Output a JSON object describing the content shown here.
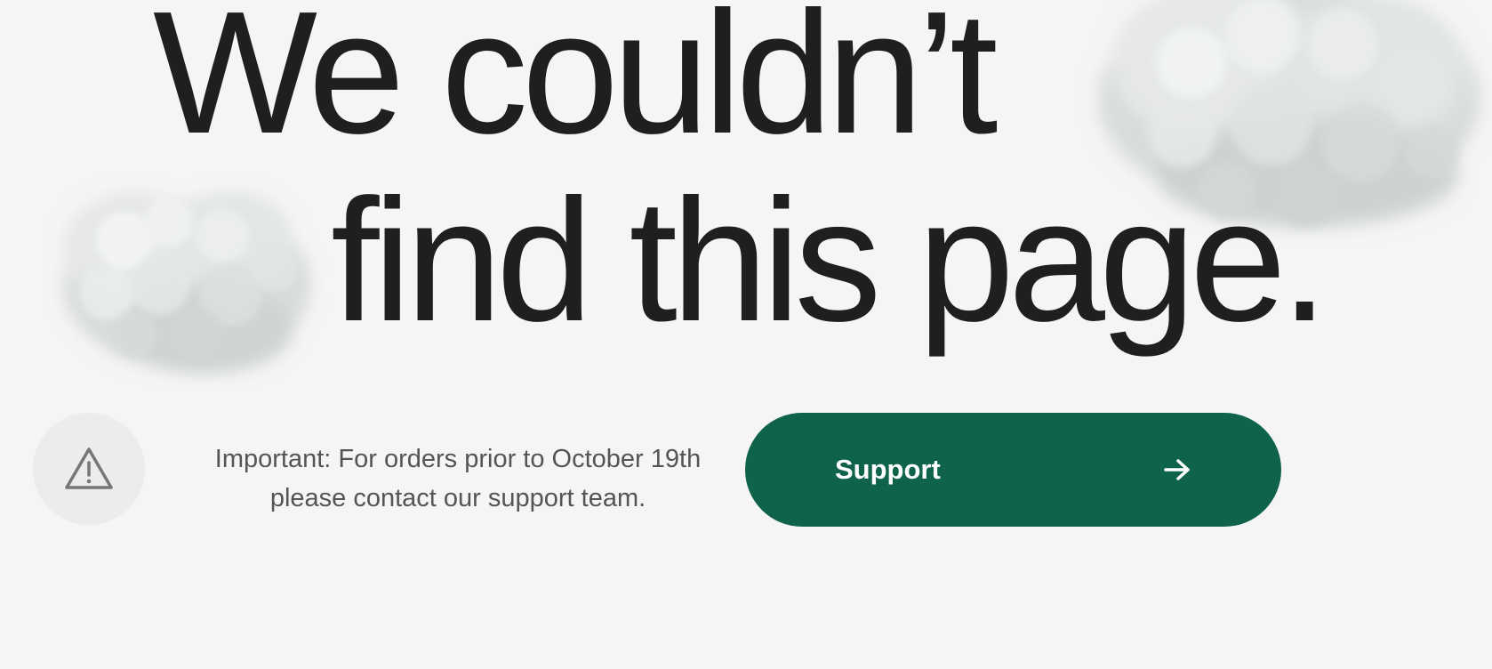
{
  "headline": {
    "line1": "We couldn’t",
    "line2": "find this page."
  },
  "notice": {
    "icon": "warning-triangle-icon",
    "text": "Important: For orders prior to October 19th please contact our support team."
  },
  "support_button": {
    "label": "Support",
    "icon": "arrow-right-icon"
  },
  "colors": {
    "background": "#f5f5f5",
    "headline": "#1f1f1f",
    "accent": "#10634b",
    "notice_text": "#555555",
    "icon_circle": "#ececec"
  }
}
